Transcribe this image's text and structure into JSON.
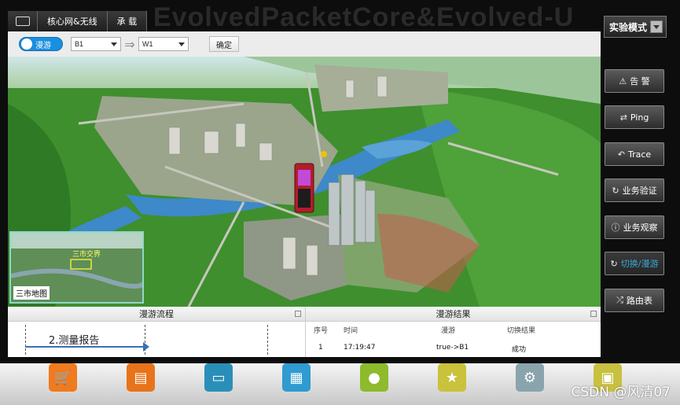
{
  "background_banner": "EvolvedPacketCore&Evolved-U",
  "breadcrumb": {
    "items": [
      "核心网&无线",
      "承 载"
    ]
  },
  "toolbar": {
    "roam_toggle": "漫游",
    "from_select": "B1",
    "to_select": "W1",
    "confirm": "确定"
  },
  "map": {
    "phone_icon": "mobile-phone-icon"
  },
  "minimap": {
    "area_label": "三市交界",
    "label": "三市地图"
  },
  "sidebar": {
    "mode": "实验模式",
    "buttons": [
      {
        "label": "告 警",
        "icon": "warning-icon"
      },
      {
        "label": "Ping",
        "icon": "ping-icon"
      },
      {
        "label": "Trace",
        "icon": "trace-icon"
      },
      {
        "label": "业务验证",
        "icon": "refresh-icon"
      },
      {
        "label": "业务观察",
        "icon": "info-icon"
      },
      {
        "label": "切换/漫游",
        "icon": "handover-icon"
      },
      {
        "label": "路由表",
        "icon": "shuffle-icon"
      }
    ]
  },
  "flow_panel": {
    "title": "漫游流程",
    "step": "2.测量报告"
  },
  "result_panel": {
    "title": "漫游结果",
    "columns": [
      "序号",
      "时间",
      "漫游",
      "切换结果"
    ],
    "rows": [
      {
        "index": "1",
        "time": "17:19:47",
        "roam": "true->B1",
        "result": "成功"
      }
    ]
  },
  "dock": {
    "icons": [
      {
        "name": "cart-icon",
        "color": "#f07a1e"
      },
      {
        "name": "notebook-icon",
        "color": "#e8731a"
      },
      {
        "name": "tv-icon",
        "color": "#2a8fb8"
      },
      {
        "name": "calendar-icon",
        "color": "#2f9bd0"
      },
      {
        "name": "chat-icon",
        "color": "#8dbb2c"
      },
      {
        "name": "star-icon",
        "color": "#c9c23a"
      },
      {
        "name": "gear-icon",
        "color": "#8aa4ad"
      },
      {
        "name": "folder-icon",
        "color": "#c8c040"
      }
    ]
  },
  "watermark": "CSDN @风清07"
}
